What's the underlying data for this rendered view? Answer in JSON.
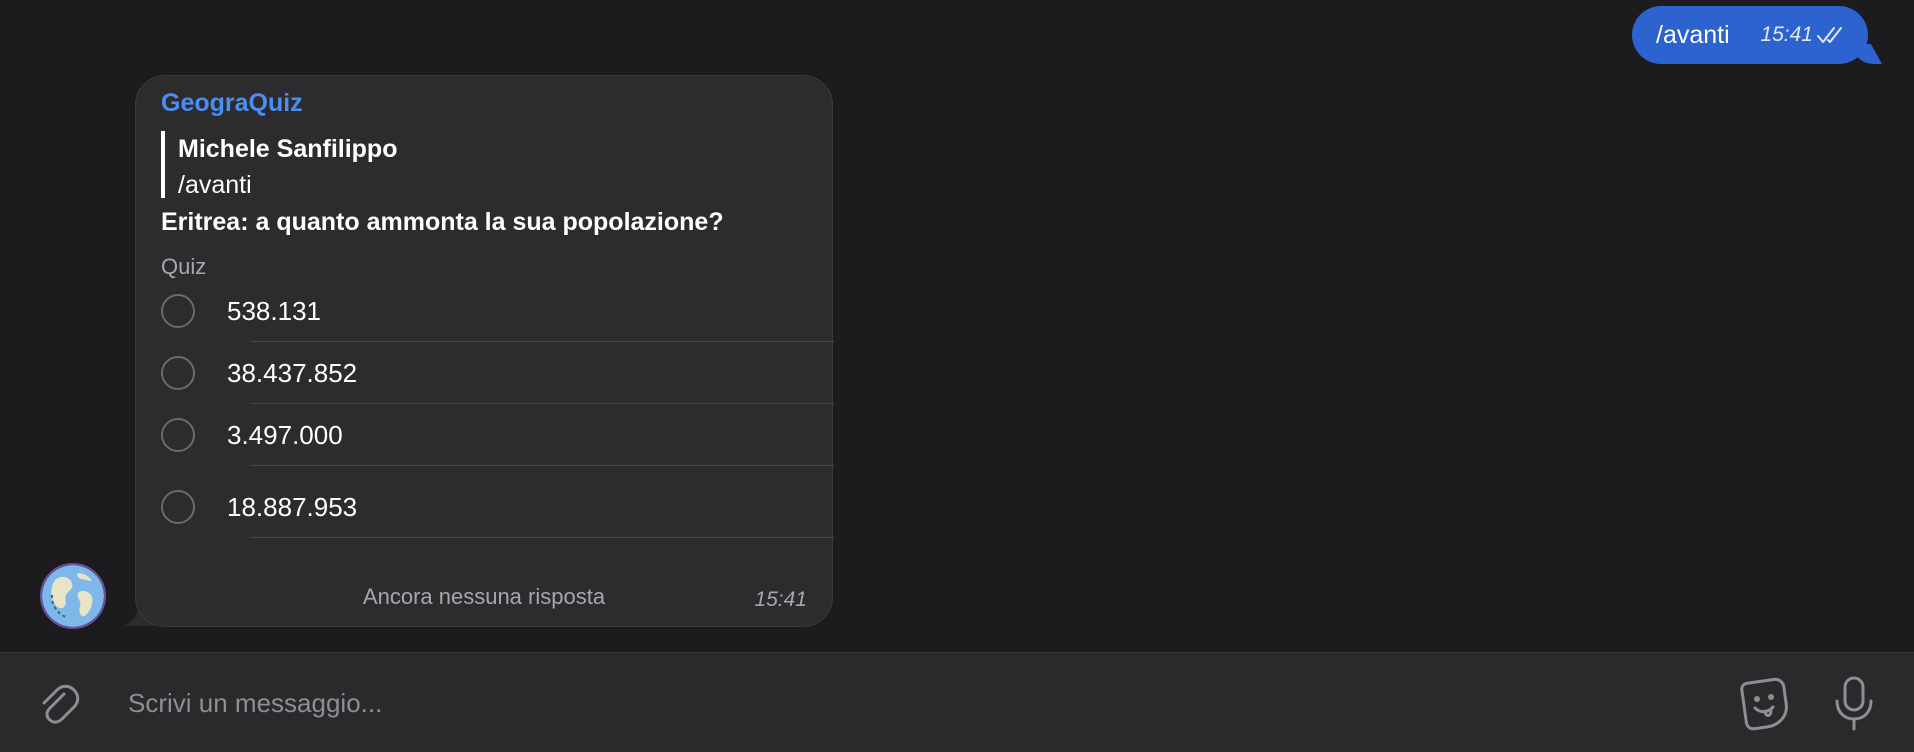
{
  "outgoing": {
    "text": "/avanti",
    "time": "15:41",
    "status_icon": "double-check-icon"
  },
  "poll_message": {
    "sender": "GeograQuiz",
    "reply": {
      "author": "Michele Sanfilippo",
      "text": "/avanti"
    },
    "question": "Eritrea: a quanto ammonta la sua popolazione?",
    "type_label": "Quiz",
    "options": [
      {
        "label": "538.131"
      },
      {
        "label": "38.437.852"
      },
      {
        "label": "3.497.000"
      },
      {
        "label": "18.887.953"
      }
    ],
    "footer": "Ancora nessuna risposta",
    "time": "15:41",
    "avatar_icon": "globe-icon"
  },
  "composer": {
    "placeholder": "Scrivi un messaggio...",
    "attach_icon": "paperclip-icon",
    "sticker_icon": "sticker-icon",
    "mic_icon": "microphone-icon"
  },
  "colors": {
    "background": "#1c1c1e",
    "outgoing_bubble": "#2c63cf",
    "incoming_bubble": "#2c2c2e",
    "sender_name": "#4b8ef2"
  }
}
